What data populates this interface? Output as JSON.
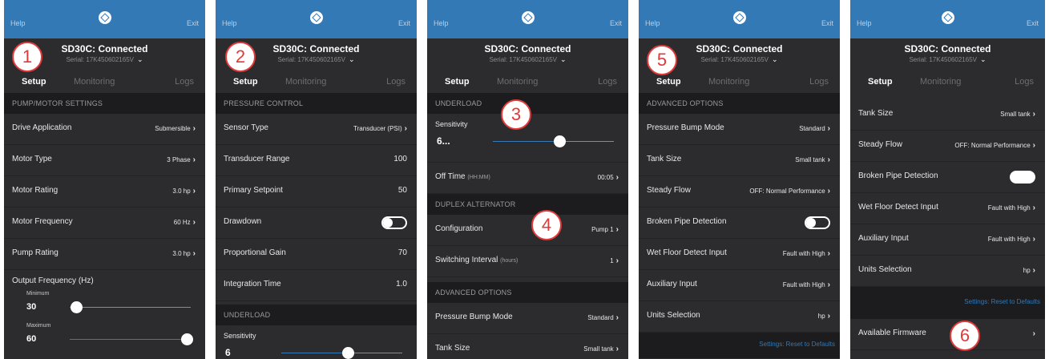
{
  "colors": {
    "accent": "#3279b5",
    "background": "#2c2c2e",
    "section": "#1c1c1e",
    "badge": "#e03a3a"
  },
  "common": {
    "nav_left": "Help",
    "nav_right": "Exit",
    "device_title": "SD30C: Connected",
    "device_serial": "Serial: 17K450602165V",
    "tabs": [
      "Setup",
      "Monitoring",
      "Logs"
    ],
    "logo_icon": "franklin-logo-icon"
  },
  "screens": [
    {
      "badge": "1",
      "section": "PUMP/MOTOR SETTINGS",
      "rows": [
        {
          "label": "Drive Application",
          "value": "Submersible"
        },
        {
          "label": "Motor Type",
          "value": "3 Phase"
        },
        {
          "label": "Motor Rating",
          "value": "3.0 hp"
        },
        {
          "label": "Motor Frequency",
          "value": "60 Hz"
        },
        {
          "label": "Pump Rating",
          "value": "3.0 hp"
        }
      ],
      "output_frequency": {
        "label": "Output Frequency (Hz)",
        "min_label": "Minimum",
        "min_value": "30",
        "min_fraction": 0.05,
        "max_label": "Maximum",
        "max_value": "60",
        "max_fraction": 0.97
      }
    },
    {
      "badge": "2",
      "section": "PRESSURE CONTROL",
      "rows": [
        {
          "label": "Sensor Type",
          "value": "Transducer (PSI)"
        },
        {
          "label": "Transducer Range",
          "value": "100"
        },
        {
          "label": "Primary Setpoint",
          "value": "50"
        },
        {
          "label": "Drawdown",
          "value": ""
        },
        {
          "label": "Proportional Gain",
          "value": "70"
        },
        {
          "label": "Integration Time",
          "value": "1.0"
        }
      ],
      "section2": "UNDERLOAD",
      "sensitivity": {
        "label": "Sensitivity",
        "value": "6",
        "fraction": 0.55
      }
    },
    {
      "badge": "3",
      "badge2": "4",
      "section": "UNDERLOAD",
      "sensitivity": {
        "label": "Sensitivity",
        "value": "6...",
        "fraction": 0.55
      },
      "off_time": {
        "label": "Off Time",
        "unit": "(HH:MM)",
        "value": "00:05"
      },
      "section2": "DUPLEX ALTERNATOR",
      "rows": [
        {
          "label": "Configuration",
          "value": "Pump 1"
        },
        {
          "label": "Switching Interval",
          "unit": "(hours)",
          "value": "1"
        }
      ],
      "section3": "ADVANCED OPTIONS",
      "rows2": [
        {
          "label": "Pressure Bump Mode",
          "value": "Standard"
        },
        {
          "label": "Tank Size",
          "value": "Small tank"
        }
      ]
    },
    {
      "badge": "5",
      "section": "ADVANCED OPTIONS",
      "rows": [
        {
          "label": "Pressure Bump Mode",
          "value": "Standard"
        },
        {
          "label": "Tank Size",
          "value": "Small tank"
        },
        {
          "label": "Steady Flow",
          "value": "OFF: Normal Performance"
        },
        {
          "label": "Broken Pipe Detection",
          "value": ""
        },
        {
          "label": "Wet Floor Detect Input",
          "value": "Fault with High"
        },
        {
          "label": "Auxiliary Input",
          "value": "Fault with High"
        },
        {
          "label": "Units Selection",
          "value": "hp"
        }
      ],
      "footer": "Settings: Reset to Defaults"
    },
    {
      "badge": "6",
      "rows": [
        {
          "label": "Tank Size",
          "value": "Small tank"
        },
        {
          "label": "Steady Flow",
          "value": "OFF: Normal Performance"
        },
        {
          "label": "Broken Pipe Detection",
          "value": ""
        },
        {
          "label": "Wet Floor Detect Input",
          "value": "Fault with High"
        },
        {
          "label": "Auxiliary Input",
          "value": "Fault with High"
        },
        {
          "label": "Units Selection",
          "value": "hp"
        }
      ],
      "footer": "Settings: Reset to Defaults",
      "firmware": "Available Firmware"
    }
  ]
}
